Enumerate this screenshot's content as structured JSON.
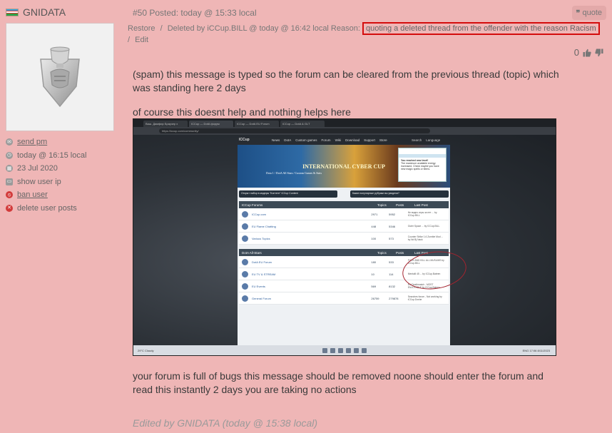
{
  "user": {
    "name": "GNIDATA",
    "flag_icon": "uzbekistan-flag-icon",
    "links": [
      {
        "label": "send pm",
        "icon": "envelope-icon",
        "underline": true
      },
      {
        "label": "today @ 16:15 local",
        "icon": "clock-icon",
        "underline": false
      },
      {
        "label": "23 Jul 2020",
        "icon": "calendar-icon",
        "underline": false
      },
      {
        "label": "show user ip",
        "icon": "monitor-icon",
        "underline": false
      },
      {
        "label": "ban user",
        "icon": "ban-icon",
        "underline": true
      },
      {
        "label": "delete user posts",
        "icon": "delete-icon",
        "underline": false
      }
    ]
  },
  "post": {
    "header": "#50 Posted: today @ 15:33 local",
    "quote_label": "quote",
    "restore_label": "Restore",
    "deleted_text": "Deleted by iCCup.BILL @ today @ 16:42 local Reason:",
    "reason": "quoting a deleted thread from the offender with the reason Racism",
    "edit_label": "Edit",
    "score": "0",
    "paragraph1": "(spam) this message is typed so the forum can be cleared from the previous thread (topic) which was standing here 2 days",
    "paragraph2": "of course this doesnt help and nothing helps here",
    "paragraph3": "your forum is full of bugs this message should be removed noone should enter the forum and read this instantly 2 days you are taking no actions",
    "edited": "Edited by GNIDATA (today @ 15:38 local)"
  },
  "screenshot": {
    "tabs": [
      "Ваш. Дамфир Браузер х",
      "ICCup — DotA форум",
      "ICCup — DotA EU Forum",
      "iCCup — DotA & GLT"
    ],
    "url": "https://iccup.com/community/",
    "logo": "ICCup",
    "menu": [
      "News",
      "DotA",
      "Custom games",
      "Forum",
      "Wiki",
      "Download",
      "Support",
      "Store"
    ],
    "right_menu": [
      "Search",
      "Language"
    ],
    "banner_title": "INTERNATIONAL CYBER CUP",
    "banner_sub": "Dota 1 / DotA All Stars / Custom Games & Stats",
    "notice_title": "You reached new level!",
    "notice_text": "The maximum available energy increased. Check maybe you have new magic spells or items.",
    "announcements": [
      "Открыт набор в модеры \"Контент\" iCCup Content",
      "Какие популярные рубрики вы увидели?"
    ],
    "forums_header": {
      "title": "ICCup Forums",
      "topics": "Topics",
      "posts": "Posts",
      "last": "Last Post"
    },
    "forums": [
      {
        "name": "ICCup.com",
        "topics": "2971",
        "posts": "5952",
        "last": "Не видно игры за нет ... by ICCup.BILL"
      },
      {
        "name": "EU Flame Chatting",
        "topics": "448",
        "posts": "5346",
        "last": "Outer Space ... by ICCup.BILL"
      },
      {
        "name": "Various Topics",
        "topics": "100",
        "posts": "573",
        "last": "Counter Strike 1.6 Zombie Mod ... by Nd Bj Nack"
      }
    ],
    "dota_header": {
      "title": "DotA All-Stars",
      "topics": "Topics",
      "posts": "Posts",
      "last": "Last Post"
    },
    "dota_forums": [
      {
        "name": "DotA EU Forum",
        "topics": "180",
        "posts": "533",
        "last": "FUCK AND KILL ALL MUSLIMS by ICCup.BILL"
      },
      {
        "name": "EU TV & STREAM",
        "topics": "10",
        "posts": "114",
        "last": "Mentalli 45 ... by ICCup.Bateen"
      },
      {
        "name": "EU Events",
        "topics": "569",
        "posts": "8132",
        "last": "EU Deathmatch - MOST ENJOYABLE by ICCup.Bateen"
      },
      {
        "name": "General Forum",
        "topics": "26759",
        "posts": "279878",
        "last": "Searches forum - Not working by iCCup.Doshe"
      }
    ],
    "taskbar_left": "29°C Cloudy",
    "taskbar_right": "ENG 17:06 8/11/2023"
  },
  "colors": {
    "background": "#efb6b6",
    "reason_border": "#d40d0d",
    "link_icon": "#9a9a9a",
    "danger_icon": "#d23a3a"
  }
}
